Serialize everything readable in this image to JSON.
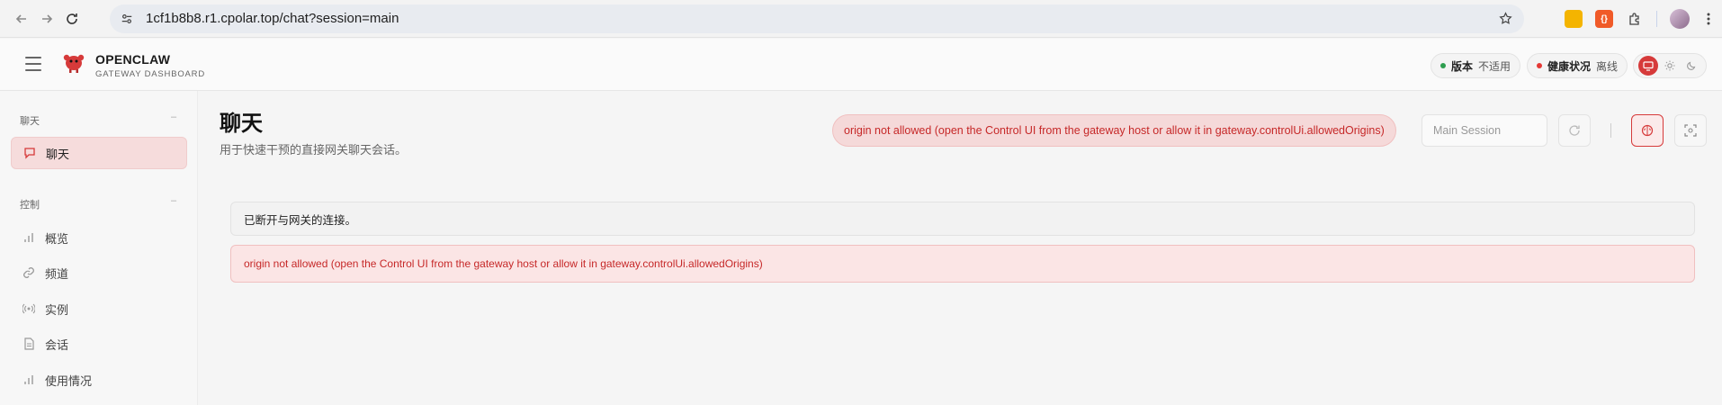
{
  "browser": {
    "url": "1cf1b8b8.r1.cpolar.top/chat?session=main"
  },
  "header": {
    "brand_title": "OPENCLAW",
    "brand_subtitle": "GATEWAY DASHBOARD",
    "version_label": "版本",
    "version_value": "不适用",
    "health_label": "健康状况",
    "health_value": "离线",
    "version_dot_color": "#2e9e4f",
    "health_dot_color": "#e53935"
  },
  "sidebar": {
    "sections": [
      {
        "title": "聊天",
        "items": [
          {
            "label": "聊天",
            "icon": "message-icon",
            "active": true
          }
        ]
      },
      {
        "title": "控制",
        "items": [
          {
            "label": "概览",
            "icon": "bar-chart-icon"
          },
          {
            "label": "频道",
            "icon": "link-icon"
          },
          {
            "label": "实例",
            "icon": "radio-icon"
          },
          {
            "label": "会话",
            "icon": "document-icon"
          },
          {
            "label": "使用情况",
            "icon": "bar-chart-icon"
          }
        ]
      }
    ]
  },
  "main": {
    "title": "聊天",
    "subtitle": "用于快速干预的直接网关聊天会话。",
    "error_pill": "origin not allowed (open the Control UI from the gateway host or allow it in gateway.controlUi.allowedOrigins)",
    "session_placeholder": "Main Session",
    "notice": "已断开与网关的连接。",
    "error_box": "origin not allowed (open the Control UI from the gateway host or allow it in gateway.controlUi.allowedOrigins)"
  },
  "colors": {
    "accent": "#d63a3a",
    "error_text": "#c62828"
  }
}
